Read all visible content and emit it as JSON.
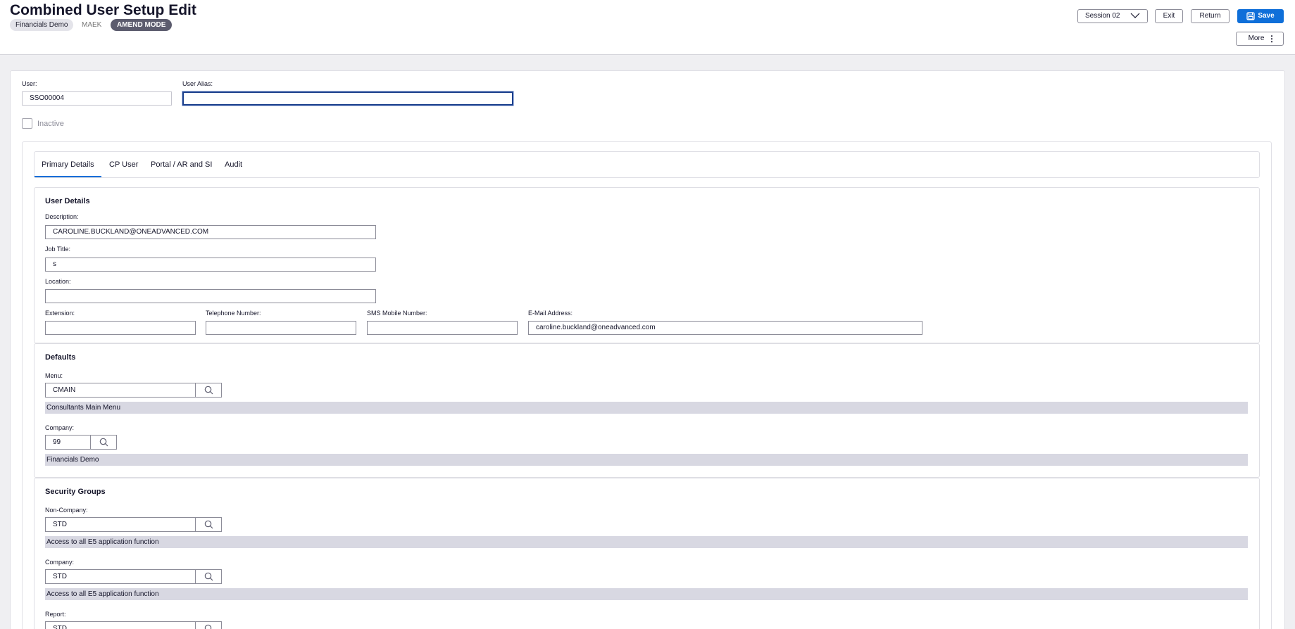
{
  "header": {
    "title": "Combined User Setup Edit",
    "company_chip": "Financials Demo",
    "company_code": "MAEK",
    "mode_chip": "AMEND MODE",
    "session_label": "Session 02",
    "exit_label": "Exit",
    "return_label": "Return",
    "save_label": "Save",
    "more_label": "More"
  },
  "form": {
    "user_label": "User:",
    "user_value": "SSO00004",
    "alias_label": "User Alias:",
    "alias_value": "",
    "inactive_label": "Inactive",
    "inactive_checked": false
  },
  "tabs": [
    "Primary Details",
    "CP User",
    "Portal / AR and SI",
    "Audit"
  ],
  "user_details": {
    "title": "User Details",
    "description_label": "Description:",
    "description_value": "CAROLINE.BUCKLAND@ONEADVANCED.COM",
    "job_title_label": "Job Title:",
    "job_title_value": "s",
    "location_label": "Location:",
    "location_value": "",
    "extension_label": "Extension:",
    "extension_value": "",
    "telephone_label": "Telephone Number:",
    "telephone_value": "",
    "sms_label": "SMS Mobile Number:",
    "sms_value": "",
    "email_label": "E-Mail Address:",
    "email_value": "caroline.buckland@oneadvanced.com"
  },
  "defaults": {
    "title": "Defaults",
    "menu_label": "Menu:",
    "menu_value": "CMAIN",
    "menu_desc": "Consultants Main Menu",
    "company_label": "Company:",
    "company_value": "99",
    "company_desc": "Financials Demo"
  },
  "security_groups": {
    "title": "Security Groups",
    "non_company_label": "Non-Company:",
    "non_company_value": "STD",
    "non_company_desc": "Access to all E5 application function",
    "company_label": "Company:",
    "company_value": "STD",
    "company_desc": "Access to all E5 application function",
    "report_label": "Report:",
    "report_value": "STD"
  },
  "colors": {
    "accent": "#0f6fd9",
    "mode_chip": "#5c5c6e",
    "desc_bar": "#d8d8e2",
    "page_bg": "#efeff2"
  }
}
